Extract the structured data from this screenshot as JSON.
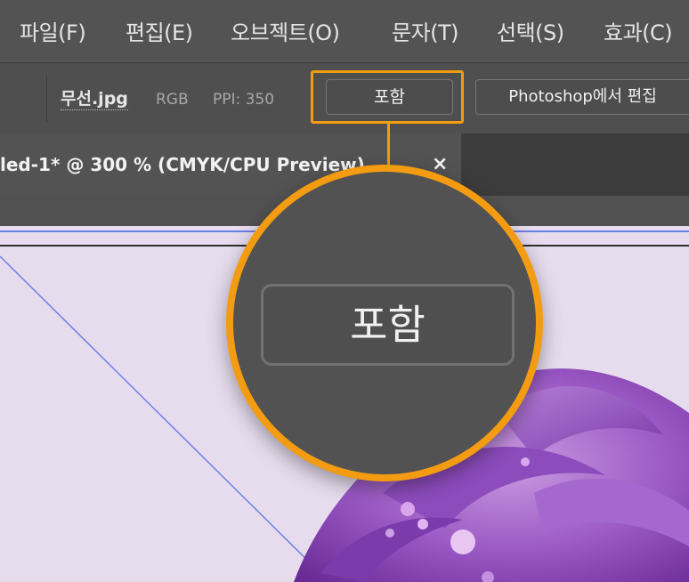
{
  "menu": {
    "items": [
      "파일(F)",
      "편집(E)",
      "오브젝트(O)",
      "문자(T)",
      "선택(S)",
      "효과(C)"
    ]
  },
  "control_bar": {
    "filename": "무선.jpg",
    "color_mode": "RGB",
    "ppi": "PPI: 350",
    "embed_label": "포함",
    "edit_in_photoshop_label": "Photoshop에서 편집"
  },
  "document_tab": {
    "title": "led-1* @ 300 % (CMYK/CPU Preview)",
    "close_symbol": "×"
  },
  "callout": {
    "zoomed_label": "포함",
    "highlight_color": "#f39c11"
  },
  "colors": {
    "chrome": "#535353",
    "pasteboard": "#e6dcee",
    "guide": "#6b7fe6"
  }
}
